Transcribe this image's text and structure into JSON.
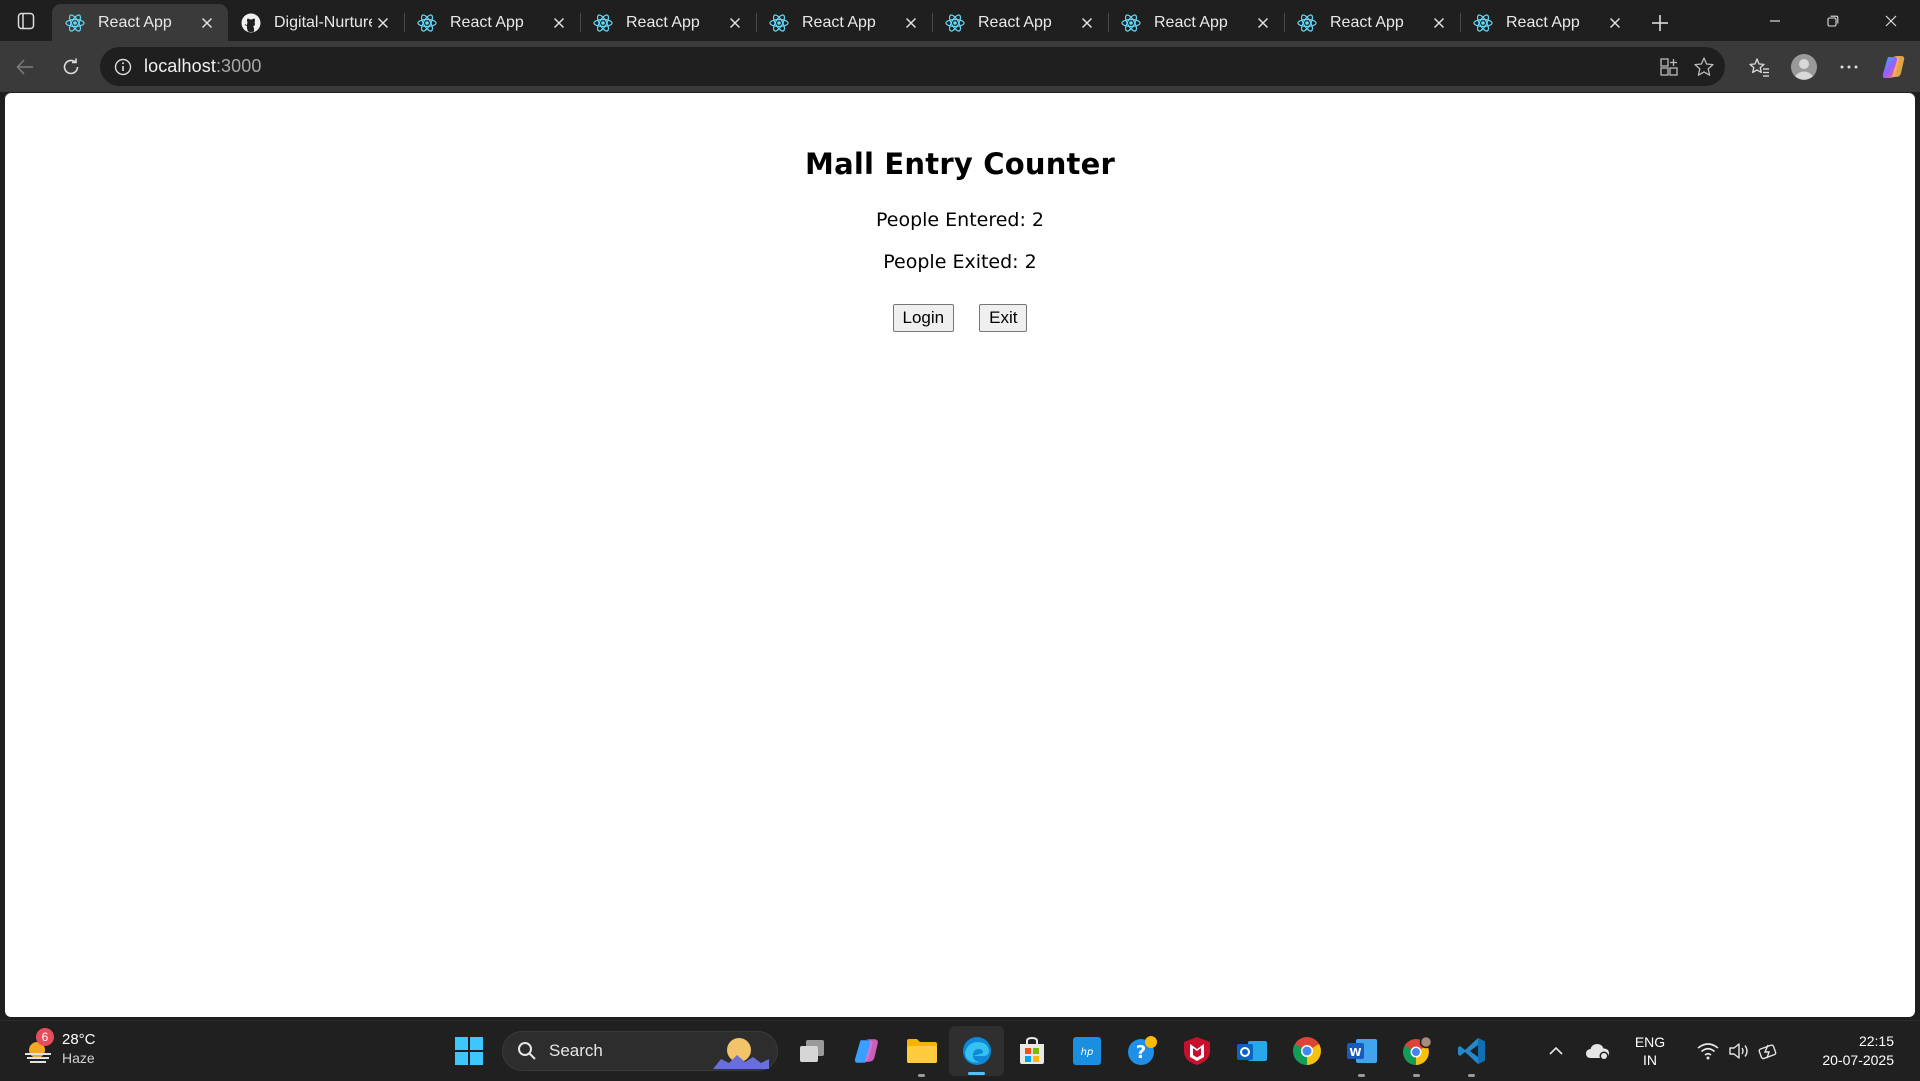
{
  "browser": {
    "tabs": [
      {
        "title": "React App",
        "favicon": "react-icon",
        "active": true
      },
      {
        "title": "Digital-Nurture",
        "favicon": "github-icon",
        "active": false
      },
      {
        "title": "React App",
        "favicon": "react-icon",
        "active": false
      },
      {
        "title": "React App",
        "favicon": "react-icon",
        "active": false
      },
      {
        "title": "React App",
        "favicon": "react-icon",
        "active": false
      },
      {
        "title": "React App",
        "favicon": "react-icon",
        "active": false
      },
      {
        "title": "React App",
        "favicon": "react-icon",
        "active": false
      },
      {
        "title": "React App",
        "favicon": "react-icon",
        "active": false
      },
      {
        "title": "React App",
        "favicon": "react-icon",
        "active": false
      }
    ],
    "address": {
      "host": "localhost",
      "port": ":3000"
    }
  },
  "page": {
    "title": "Mall Entry Counter",
    "entered_text": "People Entered: 2",
    "exited_text": "People Exited: 2",
    "login_label": "Login",
    "exit_label": "Exit"
  },
  "taskbar": {
    "weather": {
      "temp": "28°C",
      "condition": "Haze",
      "badge": "6"
    },
    "search_label": "Search",
    "tray": {
      "lang_line1": "ENG",
      "lang_line2": "IN",
      "time": "22:15",
      "date": "20-07-2025"
    }
  },
  "colors": {
    "accent": "#4cc2ff",
    "page_bg": "#ffffff",
    "chrome_bg": "#1f1f1f",
    "toolbar_bg": "#3a3a3a"
  }
}
